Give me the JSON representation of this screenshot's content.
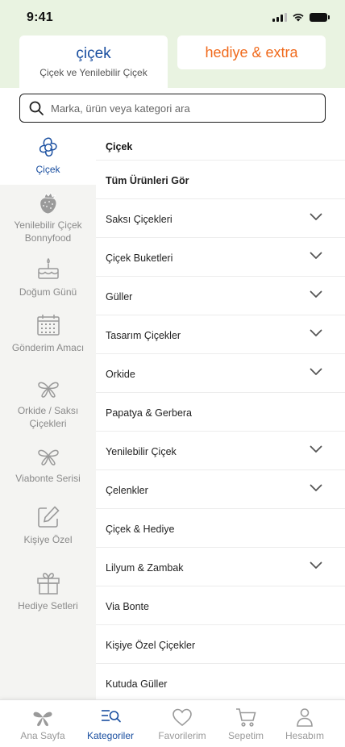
{
  "status_bar": {
    "time": "9:41"
  },
  "header_tabs": {
    "cicek": {
      "title": "çiçek",
      "subtitle": "Çiçek ve Yenilebilir Çiçek"
    },
    "hediye": {
      "title": "hediye & extra"
    }
  },
  "search": {
    "placeholder": "Marka, ürün veya kategori ara"
  },
  "rail": [
    {
      "label": "Çiçek",
      "icon": "flower-icon",
      "active": true
    },
    {
      "label": "Yenilebilir Çiçek Bonnyfood",
      "icon": "strawberry-icon"
    },
    {
      "label": "Doğum Günü",
      "icon": "cake-icon"
    },
    {
      "label": "Gönderim Amacı",
      "icon": "calendar-icon"
    },
    {
      "label": "Orkide / Saksı Çiçekleri",
      "icon": "orchid-icon"
    },
    {
      "label": "Viabonte Serisi",
      "icon": "viabonte-icon"
    },
    {
      "label": "Kişiye Özel",
      "icon": "edit-icon"
    },
    {
      "label": "Hediye Setleri",
      "icon": "gift-icon"
    }
  ],
  "list": {
    "heading": "Çiçek",
    "items": [
      {
        "label": "Tüm Ürünleri Gör",
        "expandable": false,
        "bold": true
      },
      {
        "label": "Saksı Çiçekleri",
        "expandable": true
      },
      {
        "label": "Çiçek Buketleri",
        "expandable": true
      },
      {
        "label": "Güller",
        "expandable": true
      },
      {
        "label": "Tasarım Çiçekler",
        "expandable": true
      },
      {
        "label": "Orkide",
        "expandable": true
      },
      {
        "label": "Papatya & Gerbera",
        "expandable": false
      },
      {
        "label": "Yenilebilir Çiçek",
        "expandable": true
      },
      {
        "label": "Çelenkler",
        "expandable": true
      },
      {
        "label": "Çiçek & Hediye",
        "expandable": false
      },
      {
        "label": "Lilyum & Zambak",
        "expandable": true
      },
      {
        "label": "Via Bonte",
        "expandable": false
      },
      {
        "label": "Kişiye Özel Çiçekler",
        "expandable": false
      },
      {
        "label": "Kutuda Güller",
        "expandable": false
      }
    ]
  },
  "bottom_nav": [
    {
      "label": "Ana Sayfa",
      "icon": "home-logo-icon"
    },
    {
      "label": "Kategoriler",
      "icon": "categories-search-icon",
      "active": true
    },
    {
      "label": "Favorilerim",
      "icon": "heart-icon"
    },
    {
      "label": "Sepetim",
      "icon": "cart-icon"
    },
    {
      "label": "Hesabım",
      "icon": "user-icon"
    }
  ],
  "colors": {
    "brand_blue": "#1a4fa0",
    "accent_orange": "#f06a1c",
    "header_green": "#e9f3e1",
    "rail_gray": "#f4f4f2"
  }
}
